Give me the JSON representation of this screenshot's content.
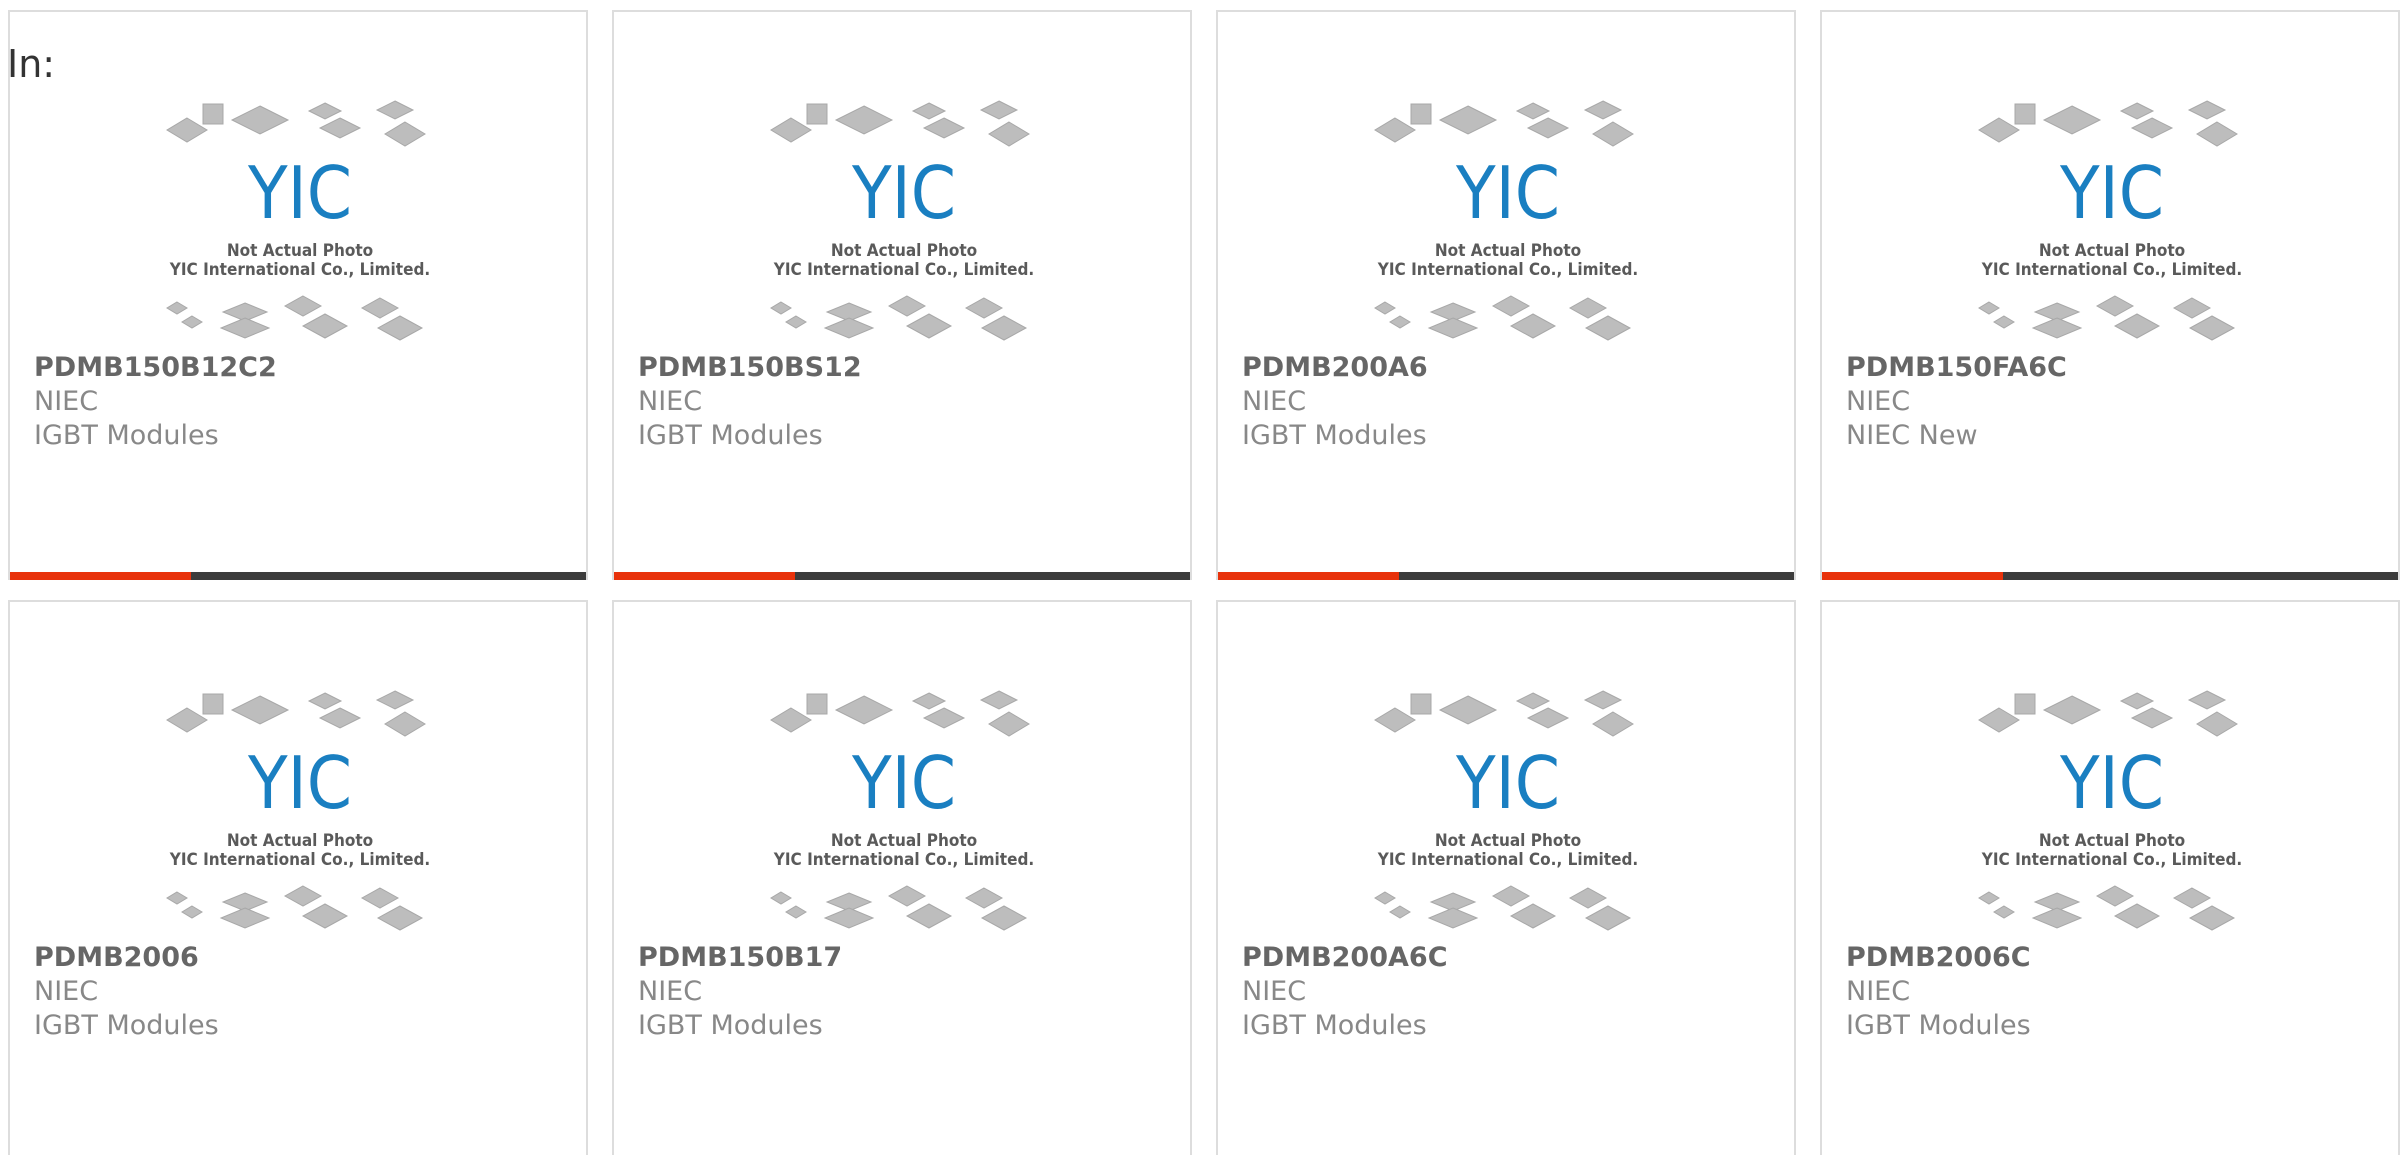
{
  "header": {
    "label": "In:"
  },
  "placeholder": {
    "line1": "Not Actual Photo",
    "line2": "YIC International Co., Limited.",
    "logo_text": "YIC"
  },
  "colors": {
    "accent": "#e8320b",
    "bar": "#3c3c3c",
    "logo": "#1a7fc1",
    "chip": "#bdbdbd"
  },
  "products": [
    {
      "part": "PDMB150B12C2",
      "manufacturer": "NIEC",
      "category": "IGBT Modules"
    },
    {
      "part": "PDMB150BS12",
      "manufacturer": "NIEC",
      "category": "IGBT Modules"
    },
    {
      "part": "PDMB200A6",
      "manufacturer": "NIEC",
      "category": "IGBT Modules"
    },
    {
      "part": "PDMB150FA6C",
      "manufacturer": "NIEC",
      "category": "NIEC New"
    },
    {
      "part": "PDMB2006",
      "manufacturer": "NIEC",
      "category": "IGBT Modules"
    },
    {
      "part": "PDMB150B17",
      "manufacturer": "NIEC",
      "category": "IGBT Modules"
    },
    {
      "part": "PDMB200A6C",
      "manufacturer": "NIEC",
      "category": "IGBT Modules"
    },
    {
      "part": "PDMB2006C",
      "manufacturer": "NIEC",
      "category": "IGBT Modules"
    }
  ]
}
